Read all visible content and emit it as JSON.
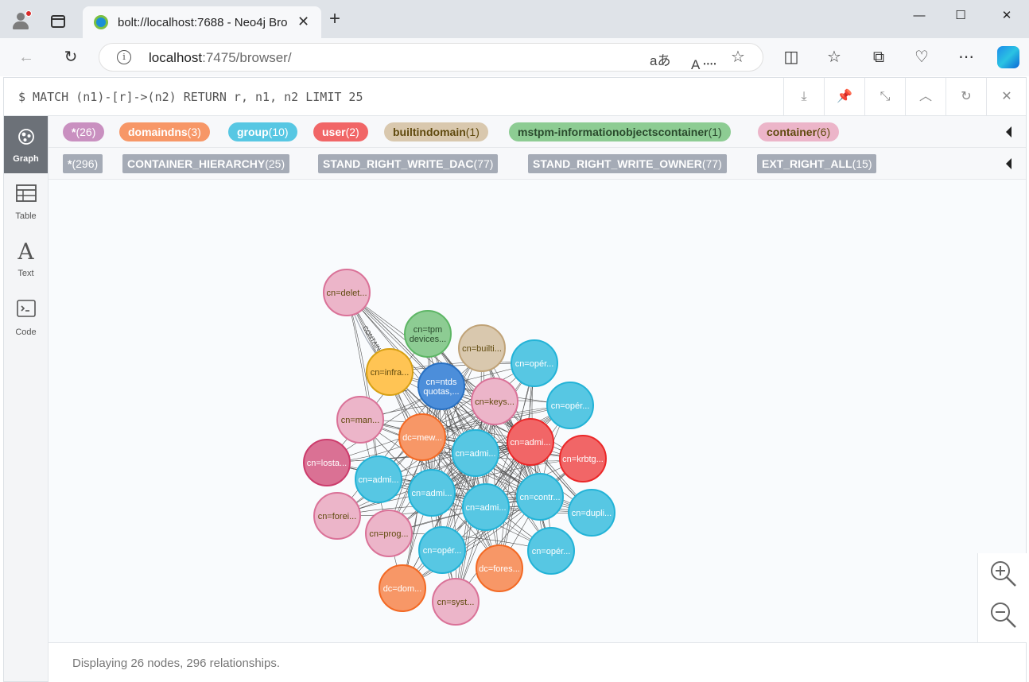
{
  "browser": {
    "tab_title": "bolt://localhost:7688 - Neo4j Bro",
    "url_host": "localhost",
    "url_rest": ":7475/browser/"
  },
  "query": "$ MATCH (n1)-[r]->(n2) RETURN r, n1, n2 LIMIT 25",
  "sidebar": {
    "items": [
      {
        "label": "Graph"
      },
      {
        "label": "Table"
      },
      {
        "label": "Text"
      },
      {
        "label": "Code"
      }
    ]
  },
  "node_labels": [
    {
      "name": "*",
      "count": "(26)",
      "color": "#c990c0",
      "text": "#ffffff"
    },
    {
      "name": "domaindns",
      "count": "(3)",
      "color": "#f79767",
      "text": "#ffffff"
    },
    {
      "name": "group",
      "count": "(10)",
      "color": "#57c7e3",
      "text": "#ffffff"
    },
    {
      "name": "user",
      "count": "(2)",
      "color": "#f16667",
      "text": "#ffffff"
    },
    {
      "name": "builtindomain",
      "count": "(1)",
      "color": "#d9c8ae",
      "text": "#604a0e"
    },
    {
      "name": "mstpm-informationobjectscontainer",
      "count": "(1)",
      "color": "#8dcc93",
      "text": "#2a4a2d"
    },
    {
      "name": "container",
      "count": "(6)",
      "color": "#ecb5c9",
      "text": "#604a0e"
    }
  ],
  "rel_types": [
    {
      "name": "*",
      "count": "(296)"
    },
    {
      "name": "CONTAINER_HIERARCHY",
      "count": "(25)"
    },
    {
      "name": "STAND_RIGHT_WRITE_DAC",
      "count": "(77)"
    },
    {
      "name": "STAND_RIGHT_WRITE_OWNER",
      "count": "(77)"
    },
    {
      "name": "EXT_RIGHT_ALL",
      "count": "(15)"
    }
  ],
  "graph": {
    "nodes": [
      {
        "label": "cn=delet...",
        "type": "container"
      },
      {
        "label": "cn=tpm devices...",
        "type": "mstpm"
      },
      {
        "label": "cn=builti...",
        "type": "builtin"
      },
      {
        "label": "cn=infra...",
        "type": "infra"
      },
      {
        "label": "cn=ntds quotas,...",
        "type": "ntds"
      },
      {
        "label": "cn=opér...",
        "type": "group"
      },
      {
        "label": "cn=keys...",
        "type": "container"
      },
      {
        "label": "cn=opér...",
        "type": "group"
      },
      {
        "label": "cn=man...",
        "type": "container"
      },
      {
        "label": "dc=mew...",
        "type": "domaindns"
      },
      {
        "label": "cn=admi...",
        "type": "user"
      },
      {
        "label": "cn=admi...",
        "type": "group"
      },
      {
        "label": "cn=krbtg...",
        "type": "user"
      },
      {
        "label": "cn=losta...",
        "type": "lostfound"
      },
      {
        "label": "cn=admi...",
        "type": "group"
      },
      {
        "label": "cn=admi...",
        "type": "group"
      },
      {
        "label": "cn=admi...",
        "type": "group"
      },
      {
        "label": "cn=contr...",
        "type": "group"
      },
      {
        "label": "cn=dupli...",
        "type": "group"
      },
      {
        "label": "cn=forei...",
        "type": "container"
      },
      {
        "label": "cn=prog...",
        "type": "container"
      },
      {
        "label": "cn=opér...",
        "type": "group"
      },
      {
        "label": "cn=opér...",
        "type": "group"
      },
      {
        "label": "dc=fores...",
        "type": "domaindns"
      },
      {
        "label": "dc=dom...",
        "type": "domaindns"
      },
      {
        "label": "cn=syst...",
        "type": "container"
      }
    ],
    "edge_labels": [
      "CONTAINER_HIERARCHY",
      "STAND_RIGHT_WRITE_DAC",
      "STAND_RIGHT_WRITE_OWNER",
      "EXT_RIGHT_ALL"
    ]
  },
  "node_colors": {
    "container": {
      "fill": "#ecb5c9",
      "stroke": "#da7298",
      "text": "#604a0e"
    },
    "mstpm": {
      "fill": "#8dcc93",
      "stroke": "#5db665",
      "text": "#2a4a2d"
    },
    "builtin": {
      "fill": "#d9c8ae",
      "stroke": "#c0a378",
      "text": "#604a0e"
    },
    "infra": {
      "fill": "#ffc454",
      "stroke": "#d7a013",
      "text": "#604a0e"
    },
    "ntds": {
      "fill": "#4c8eda",
      "stroke": "#2870c2",
      "text": "#ffffff"
    },
    "group": {
      "fill": "#57c7e3",
      "stroke": "#23b3d7",
      "text": "#ffffff"
    },
    "domaindns": {
      "fill": "#f79767",
      "stroke": "#f36924",
      "text": "#ffffff"
    },
    "user": {
      "fill": "#f16667",
      "stroke": "#eb2728",
      "text": "#ffffff"
    },
    "lostfound": {
      "fill": "#da7194",
      "stroke": "#cc3c6c",
      "text": "#ffffff"
    }
  },
  "status": "Displaying 26 nodes, 296 relationships."
}
